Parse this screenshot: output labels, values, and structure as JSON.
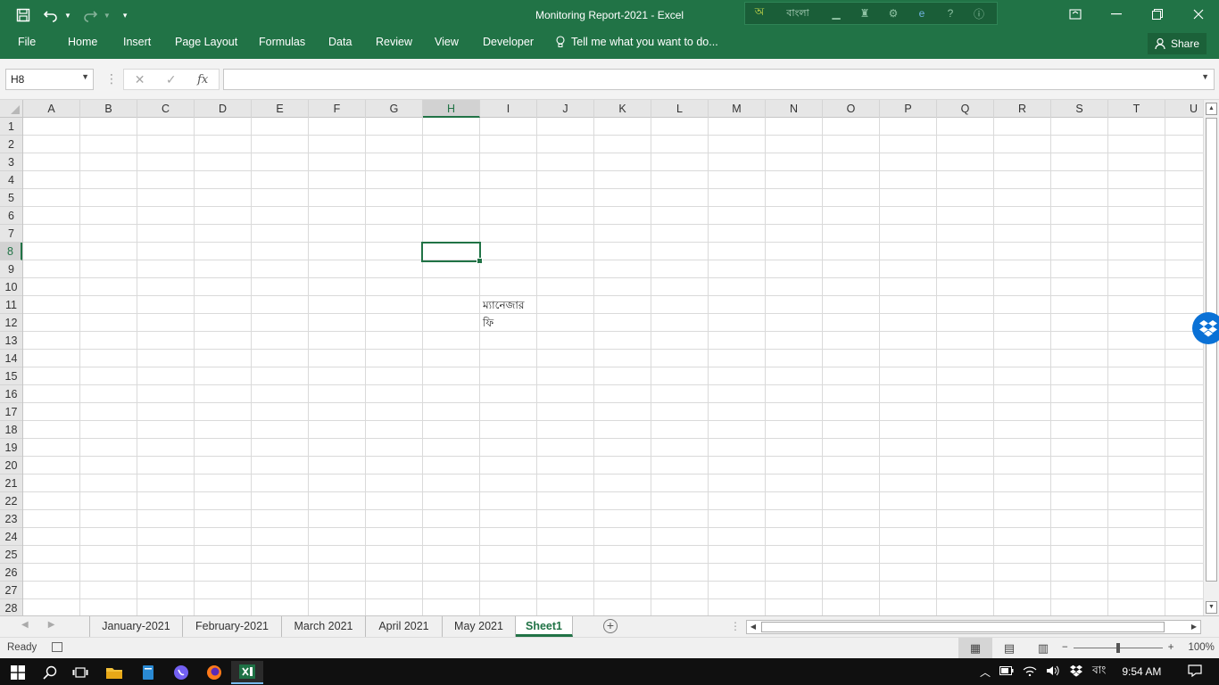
{
  "window": {
    "title": "Monitoring Report-2021 - Excel",
    "language_bar_label": "বাংলা"
  },
  "ribbon": {
    "tabs": [
      "File",
      "Home",
      "Insert",
      "Page Layout",
      "Formulas",
      "Data",
      "Review",
      "View",
      "Developer"
    ],
    "tell_me": "Tell me what you want to do...",
    "share": "Share"
  },
  "formula_bar": {
    "name_box": "H8",
    "fx_label": "fx",
    "value": ""
  },
  "grid": {
    "columns": [
      "A",
      "B",
      "C",
      "D",
      "E",
      "F",
      "G",
      "H",
      "I",
      "J",
      "K",
      "L",
      "M",
      "N",
      "O",
      "P",
      "Q",
      "R",
      "S",
      "T",
      "U"
    ],
    "rows": [
      "1",
      "2",
      "3",
      "4",
      "5",
      "6",
      "7",
      "8",
      "9",
      "10",
      "11",
      "12",
      "13",
      "14",
      "15",
      "16",
      "17",
      "18",
      "19",
      "20",
      "21",
      "22",
      "23",
      "24",
      "25",
      "26",
      "27",
      "28"
    ],
    "selected_cell": "H8",
    "cell_I11": "ম্যানেজার",
    "cell_I12": "ফি"
  },
  "sheets": {
    "tabs": [
      "January-2021",
      "February-2021",
      "March 2021",
      "April 2021",
      "May 2021",
      "Sheet1"
    ],
    "active": "Sheet1"
  },
  "status": {
    "ready": "Ready",
    "zoom": "100%"
  },
  "taskbar": {
    "language": "বাং",
    "time": "9:54 AM"
  },
  "colors": {
    "excel_green": "#217346",
    "taskbar": "#101010"
  }
}
